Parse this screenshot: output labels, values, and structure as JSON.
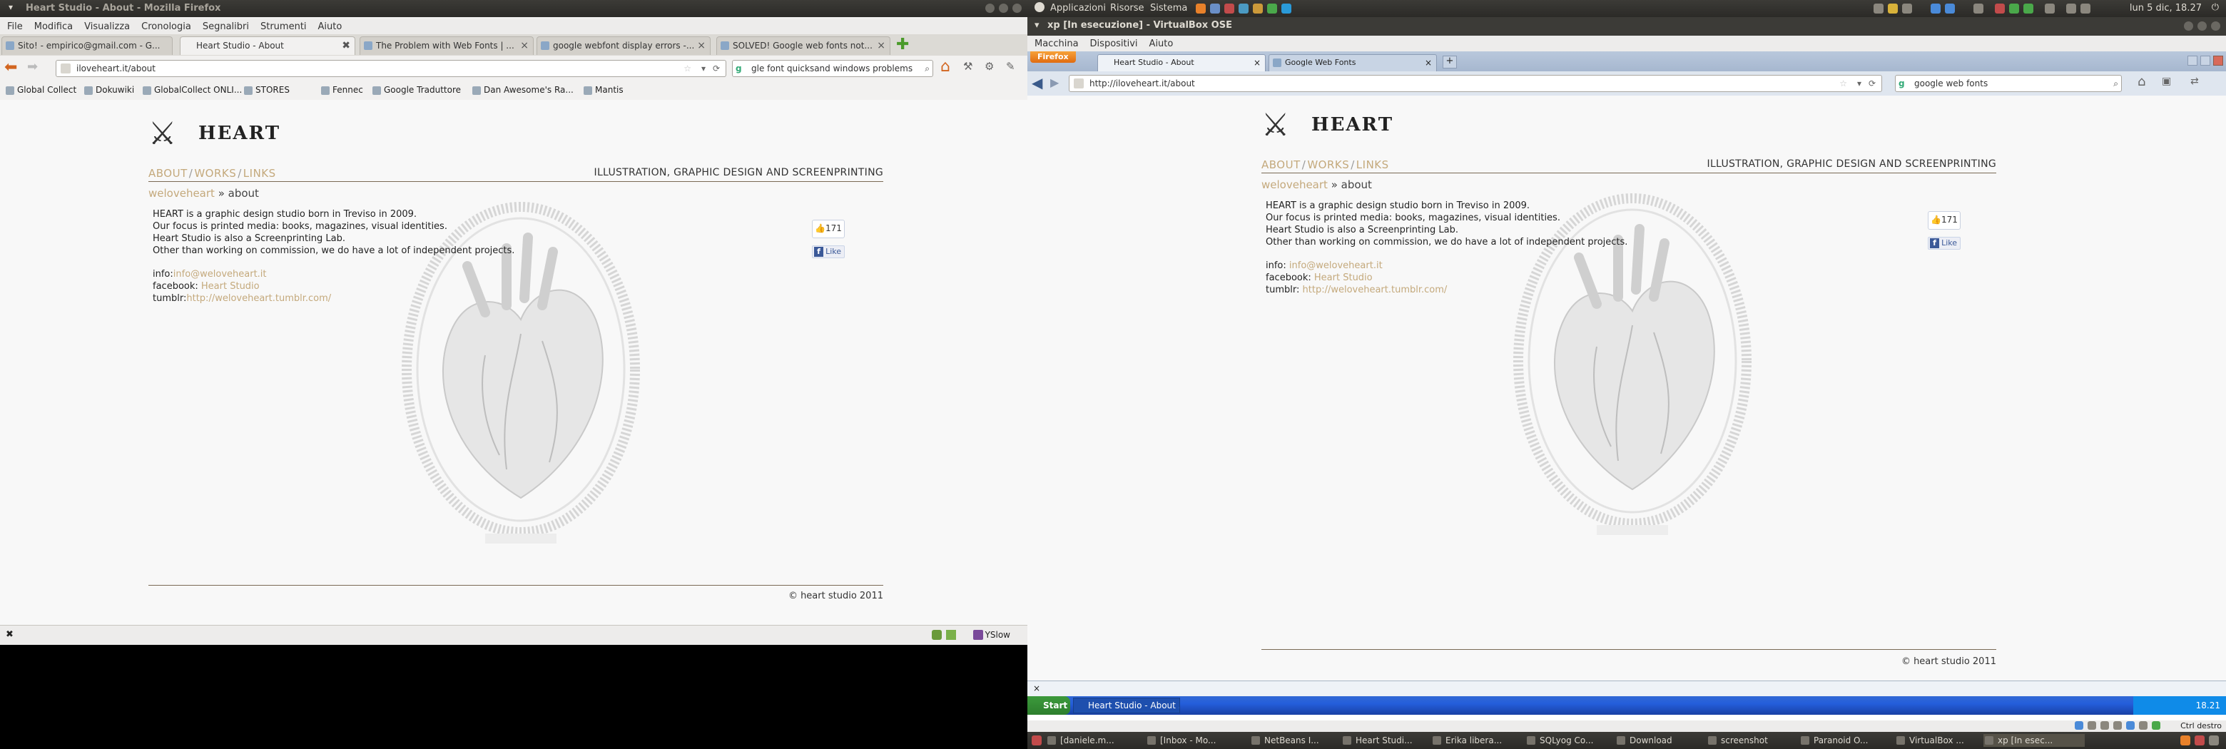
{
  "left": {
    "window_title": "Heart Studio - About - Mozilla Firefox",
    "menu": [
      "File",
      "Modifica",
      "Visualizza",
      "Cronologia",
      "Segnalibri",
      "Strumenti",
      "Aiuto"
    ],
    "tabs": [
      {
        "label": "Sito! - empirico@gmail.com - G..."
      },
      {
        "label": "Heart Studio - About"
      },
      {
        "label": "The Problem with Web Fonts | ..."
      },
      {
        "label": "google webfont display errors -..."
      },
      {
        "label": "SOLVED! Google web fonts not..."
      }
    ],
    "url": "iloveheart.it/about",
    "search_value": "gle font quicksand windows problems",
    "bookmarks": [
      "Global Collect",
      "Dokuwiki",
      "GlobalCollect ONLI...",
      "STORES",
      "Fennec",
      "Google Traduttore",
      "Dan Awesome's Ra...",
      "Mantis"
    ],
    "status_right": "YSlow"
  },
  "site": {
    "logo_text": "HEART",
    "nav": [
      "ABOUT",
      "WORKS",
      "LINKS"
    ],
    "tagline": "ILLUSTRATION, GRAPHIC DESIGN AND SCREENPRINTING",
    "crumb_link": "weloveheart",
    "crumb_current": "» about",
    "paragraphs": [
      "HEART is a graphic design studio born in Treviso in 2009.",
      "Our focus is printed media: books, magazines, visual identities.",
      "Heart Studio is also a Screenprinting Lab.",
      "Other than working on commission, we do have a lot of independent projects."
    ],
    "info_label": "info:",
    "info_value": "info@weloveheart.it",
    "facebook_label": "facebook:",
    "facebook_value": "Heart Studio",
    "tumblr_label": "tumblr:",
    "tumblr_value": "http://weloveheart.tumblr.com/",
    "like_count": "171",
    "like_label": "Like",
    "copyright": "© heart studio 2011"
  },
  "right": {
    "top_menu": [
      "Applicazioni",
      "Risorse",
      "Sistema"
    ],
    "clock": "lun  5 dic, 18.27",
    "vb_title": "xp [In esecuzione] - VirtualBox OSE",
    "vb_menu": [
      "Macchina",
      "Dispositivi",
      "Aiuto"
    ],
    "ff_button": "Firefox",
    "tabs": [
      {
        "label": "Heart Studio - About"
      },
      {
        "label": "Google Web Fonts"
      }
    ],
    "url": "http://iloveheart.it/about",
    "search_value": "google web fonts",
    "xp_start": "Start",
    "xp_task": "Heart Studio - About ...",
    "xp_clock": "18.21",
    "vb_host_key": "Ctrl destro",
    "bottom_tasks": [
      "[daniele.m...",
      "[Inbox - Mo...",
      "NetBeans I...",
      "Heart Studi...",
      "Erika libera...",
      "SQLyog Co...",
      "Download",
      "screenshot",
      "Paranoid O...",
      "VirtualBox ...",
      "xp [In esec..."
    ]
  }
}
